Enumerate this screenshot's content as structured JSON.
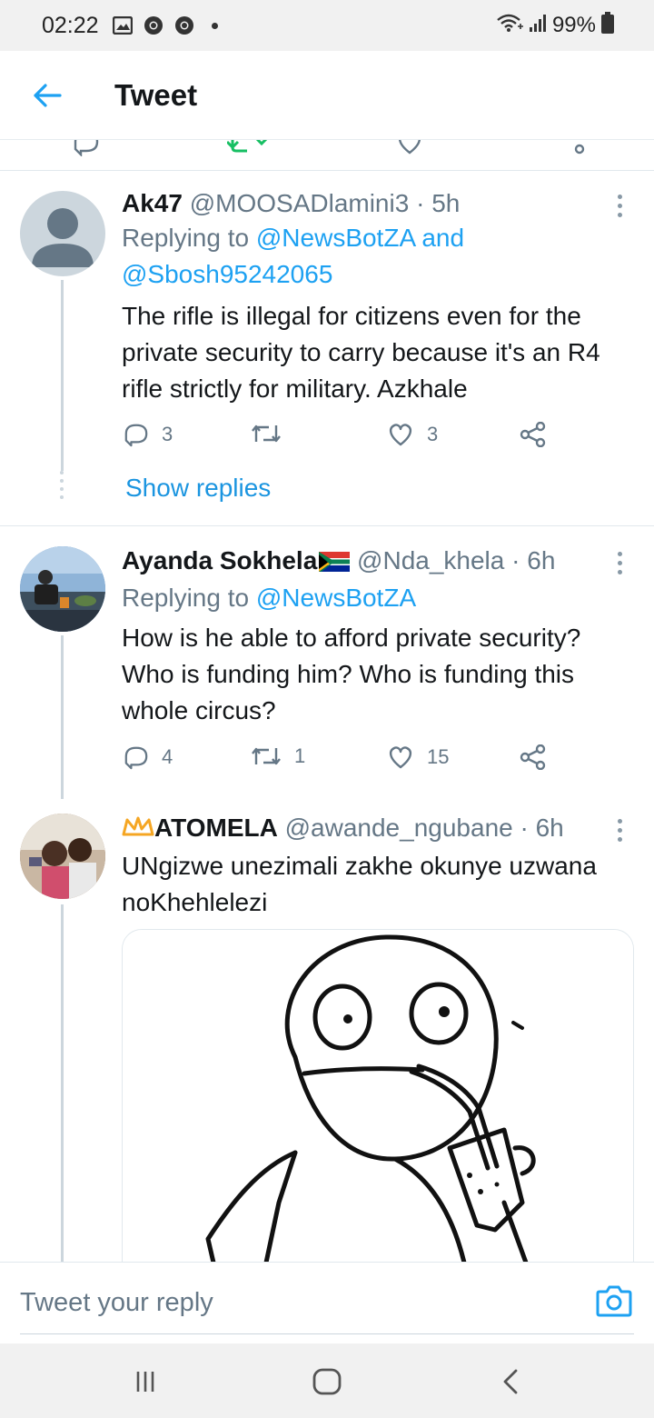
{
  "status_bar": {
    "time": "02:22",
    "battery": "99%",
    "icons": [
      "gallery-icon",
      "chrome-icon",
      "chrome-icon",
      "wifi-icon",
      "signal-icon",
      "battery-icon"
    ]
  },
  "header": {
    "title": "Tweet",
    "back_icon": "arrow-left-icon"
  },
  "tweets": [
    {
      "name": "Ak47",
      "handle": "@MOOSADlamini3",
      "time": "· 5h",
      "replying_prefix": "Replying to",
      "replying_mentions": "@NewsBotZA and",
      "replying_mentions_2": "@Sbosh95242065",
      "text": "The rifle is illegal for citizens even for the private security to carry because it's an R4 rifle strictly for military. Azkhale",
      "replies": "3",
      "retweets": "",
      "likes": "3",
      "show_replies": "Show replies"
    },
    {
      "name": "Ayanda Sokhela",
      "flag": "south-africa-flag-icon",
      "handle": "@Nda_khela",
      "time": "· 6h",
      "replying_prefix": "Replying to",
      "replying_mentions": "@NewsBotZA",
      "text": "How is he able to afford private security? Who is funding him? Who is funding this whole circus?",
      "replies": "4",
      "retweets": "1",
      "likes": "15"
    },
    {
      "name_prefix_emoji": "crown-icon",
      "name": "ATOMELA",
      "handle": "@awande_ngubane",
      "time": "· 6h",
      "text": "UNgizwe unezimali zakhe okunye uzwana noKhehlelezi",
      "media": "meme-drinking-straw-image"
    }
  ],
  "reply_bar": {
    "placeholder": "Tweet your reply",
    "camera_icon": "camera-icon"
  },
  "nav_bar": {
    "buttons": [
      "recent-apps-icon",
      "home-icon",
      "back-icon"
    ]
  },
  "colors": {
    "accent": "#1da1f2",
    "text": "#14171a",
    "secondary": "#657786",
    "divider": "#e1e8ed"
  }
}
